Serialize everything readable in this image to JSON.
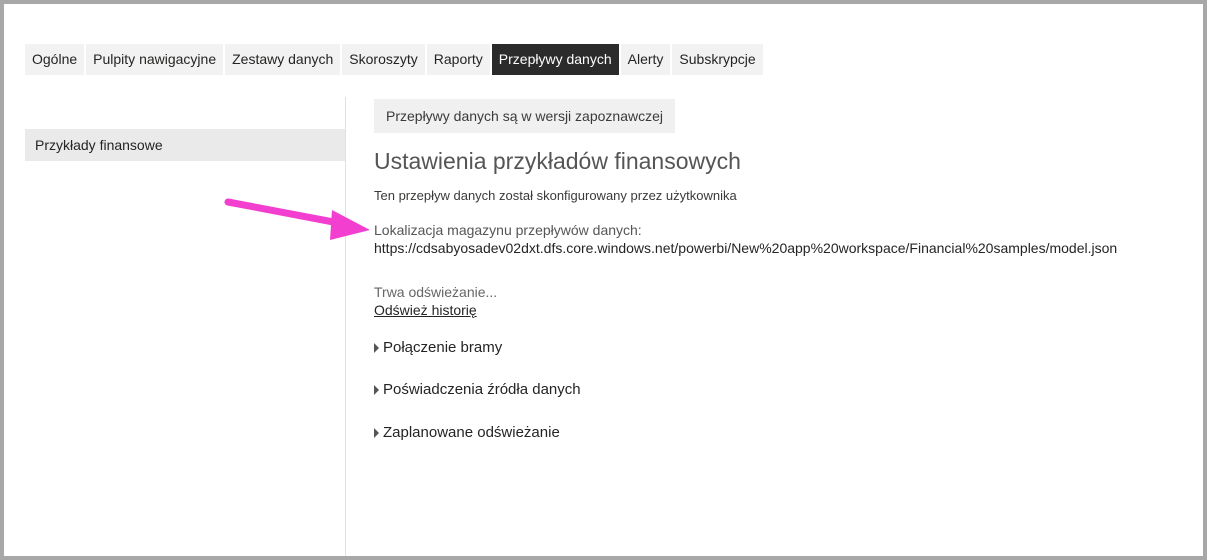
{
  "tabs": [
    {
      "label": "Ogólne",
      "active": false
    },
    {
      "label": "Pulpity nawigacyjne",
      "active": false
    },
    {
      "label": "Zestawy danych",
      "active": false
    },
    {
      "label": "Skoroszyty",
      "active": false
    },
    {
      "label": "Raporty",
      "active": false
    },
    {
      "label": "Przepływy danych",
      "active": true
    },
    {
      "label": "Alerty",
      "active": false
    },
    {
      "label": "Subskrypcje",
      "active": false
    }
  ],
  "sidebar": {
    "items": [
      {
        "label": "Przykłady finansowe",
        "selected": true
      }
    ]
  },
  "main": {
    "preview_banner": "Przepływy danych są w wersji zapoznawczej",
    "title": "Ustawienia przykładów finansowych",
    "configured_by": "Ten przepływ danych został skonfigurowany przez użytkownika",
    "storage_label": "Lokalizacja magazynu przepływów danych:",
    "storage_url": "https://cdsabyosadev02dxt.dfs.core.windows.net/powerbi/New%20app%20workspace/Financial%20samples/model.json",
    "refresh_status": "Trwa odświeżanie...",
    "refresh_history_link": "Odśwież historię",
    "sections": [
      {
        "label": "Połączenie bramy"
      },
      {
        "label": "Poświadczenia źródła danych"
      },
      {
        "label": "Zaplanowane odświeżanie"
      }
    ]
  },
  "colors": {
    "active_tab_bg": "#2b2b2b",
    "tab_bg": "#f2f2f2",
    "annotation_arrow": "#f23fcf"
  },
  "icons": {
    "section_caret": "caret-right-icon",
    "annotation": "pointer-arrow-icon"
  }
}
